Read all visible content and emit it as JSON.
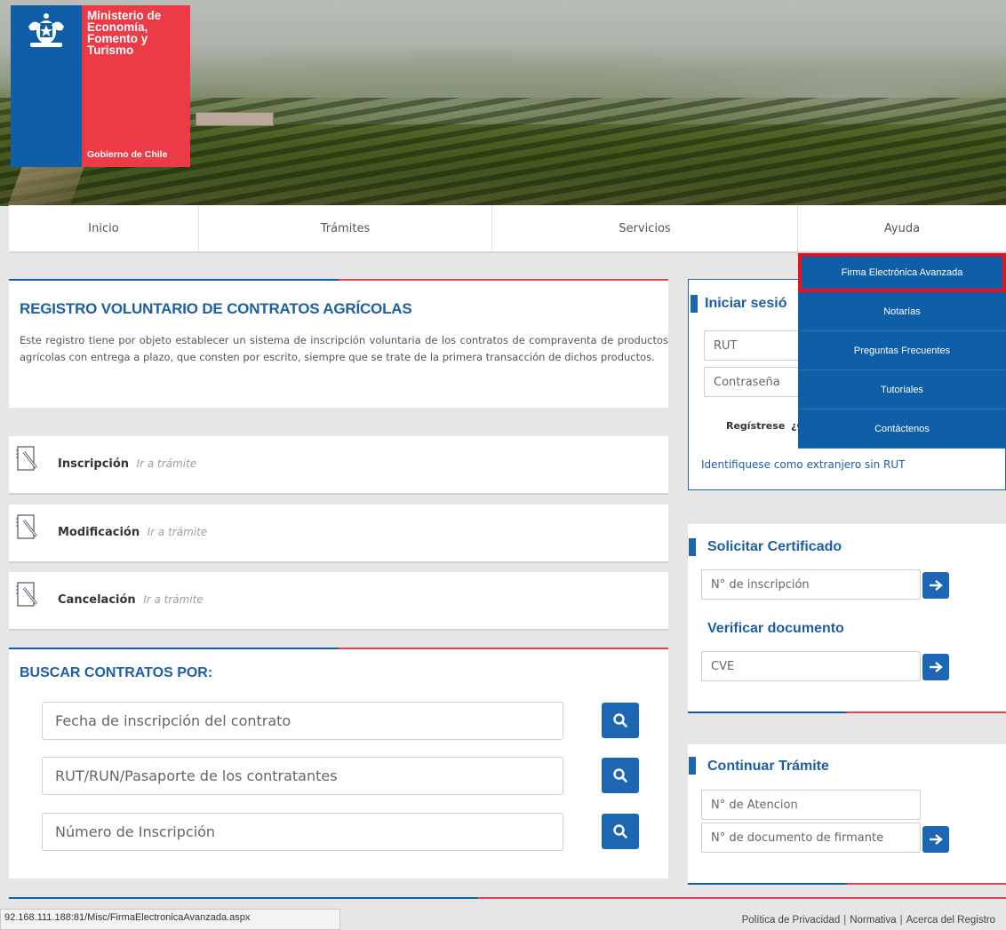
{
  "logo": {
    "ministry_line1": "Ministerio de",
    "ministry_line2": "Economía,",
    "ministry_line3": "Fomento y",
    "ministry_line4": "Turismo",
    "government": "Gobierno de Chile"
  },
  "nav": {
    "items": [
      "Inicio",
      "Trámites",
      "Servicios",
      "Ayuda"
    ]
  },
  "ayuda_menu": {
    "items": [
      "Firma Electrónica Avanzada",
      "Notarías",
      "Preguntas Frecuentes",
      "Tutoriales",
      "Contáctenos"
    ],
    "highlight_color": "#e8101f"
  },
  "registro": {
    "title": "REGISTRO VOLUNTARIO DE CONTRATOS AGRÍCOLAS",
    "description": "Este registro tiene por objeto establecer un sistema de inscripción voluntaria de los contratos de compraventa de productos agrícolas con entrega a plazo, que consten por escrito, siempre que se trate de la primera transacción de dichos productos."
  },
  "tramites": [
    {
      "label": "Inscripción",
      "link": "Ir a trámite",
      "icon": "notepad-pencil-icon"
    },
    {
      "label": "Modificación",
      "link": "Ir a trámite",
      "icon": "notepad-pencil-icon"
    },
    {
      "label": "Cancelación",
      "link": "Ir a trámite",
      "icon": "notepad-pencil-icon"
    }
  ],
  "buscar": {
    "title": "BUSCAR CONTRATOS POR:",
    "fields": [
      "Fecha de inscripción del contrato",
      "RUT/RUN/Pasaporte de los contratantes",
      "Número de Inscripción"
    ],
    "button_icon": "search-icon"
  },
  "login": {
    "title": "Iniciar sesió",
    "rut_placeholder": "RUT",
    "password_placeholder": "Contraseña",
    "register": "Regístrese",
    "forgot_partial": "¿C",
    "foreign_link": "Identifiquese como extranjero sin RUT"
  },
  "certificado": {
    "title": "Solicitar Certificado",
    "placeholder": "N° de inscripción",
    "verify_title": "Verificar documento",
    "verify_placeholder": "CVE"
  },
  "continuar": {
    "title": "Continuar Trámite",
    "atencion_placeholder": "N° de Atencion",
    "firmante_placeholder": "N° de documento de firmante"
  },
  "status_bar": {
    "url": "92.168.111.188:81/Misc/FirmaElectronicaAvanzada.aspx"
  },
  "footer": {
    "privacy": "Política de Privacidad",
    "normativa": "Normativa",
    "about": "Acerca del Registro"
  },
  "colors": {
    "brand_blue": "#0f5ea8",
    "brand_red": "#ec3a47",
    "title_blue": "#1d5fa5"
  }
}
